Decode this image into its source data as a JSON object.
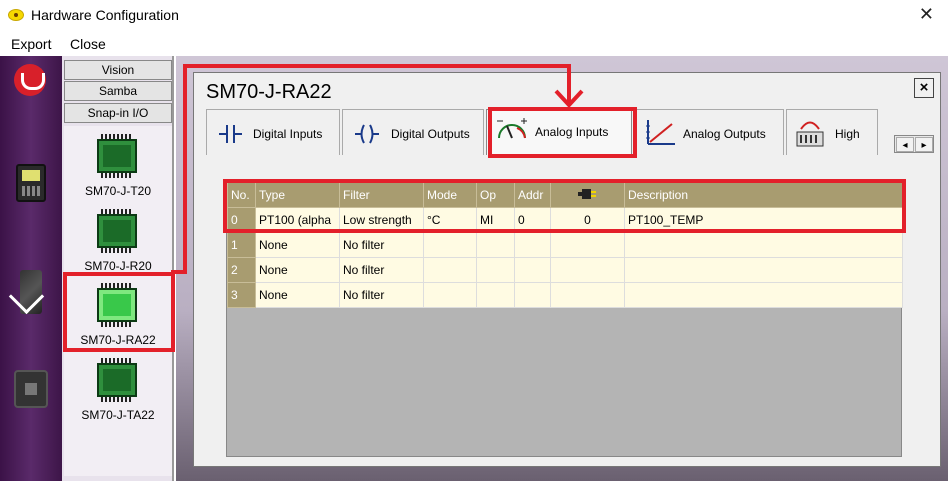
{
  "window": {
    "title": "Hardware Configuration",
    "close_glyph": "✕"
  },
  "menu": {
    "export_label": "Export",
    "close_label": "Close"
  },
  "module_tabs": [
    "Vision",
    "Samba",
    "Snap-in I/O"
  ],
  "modules": [
    {
      "label": "SM70-J-T20"
    },
    {
      "label": "SM70-J-R20"
    },
    {
      "label": "SM70-J-RA22",
      "selected": true
    },
    {
      "label": "SM70-J-TA22"
    }
  ],
  "dialog": {
    "title": "SM70-J-RA22",
    "close_glyph": "×",
    "tabs": [
      {
        "label": "Digital Inputs",
        "icon": "digital-inputs-icon"
      },
      {
        "label": "Digital Outputs",
        "icon": "digital-outputs-icon"
      },
      {
        "label": "Analog Inputs",
        "icon": "analog-inputs-icon",
        "active": true
      },
      {
        "label": "Analog Outputs",
        "icon": "analog-outputs-icon"
      },
      {
        "label": "High",
        "icon": "high-speed-icon"
      }
    ],
    "scroll_left": "◂",
    "scroll_right": "▸",
    "table": {
      "columns": [
        "No.",
        "Type",
        "Filter",
        "Mode",
        "Op",
        "Addr",
        "",
        "Description"
      ],
      "rows": [
        [
          "0",
          "PT100 (alpha",
          "Low strength",
          "°C",
          "MI",
          "0",
          "0",
          "PT100_TEMP"
        ],
        [
          "1",
          "None",
          "No filter",
          "",
          "",
          "",
          "",
          ""
        ],
        [
          "2",
          "None",
          "No filter",
          "",
          "",
          "",
          "",
          ""
        ],
        [
          "3",
          "None",
          "No filter",
          "",
          "",
          "",
          "",
          ""
        ]
      ]
    }
  },
  "colors": {
    "highlight": "#e3202a",
    "header": "#a89c70",
    "cell": "#fffbe3"
  }
}
